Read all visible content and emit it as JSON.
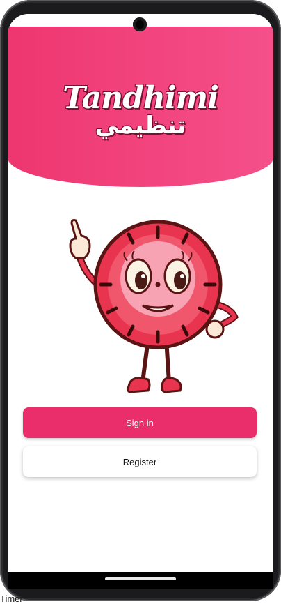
{
  "app": {
    "logo_latin": "Tandhimi",
    "logo_arabic": "تنظيمي"
  },
  "mascot": {
    "icon": "tomato-timer-mascot"
  },
  "buttons": {
    "sign_in": "Sign in",
    "register": "Register"
  },
  "colors": {
    "brand": "#ee3670",
    "brand_light": "#f5508a",
    "button_primary": "#ea2e6c",
    "text_dark": "#111111"
  },
  "footer_text": "Timer"
}
